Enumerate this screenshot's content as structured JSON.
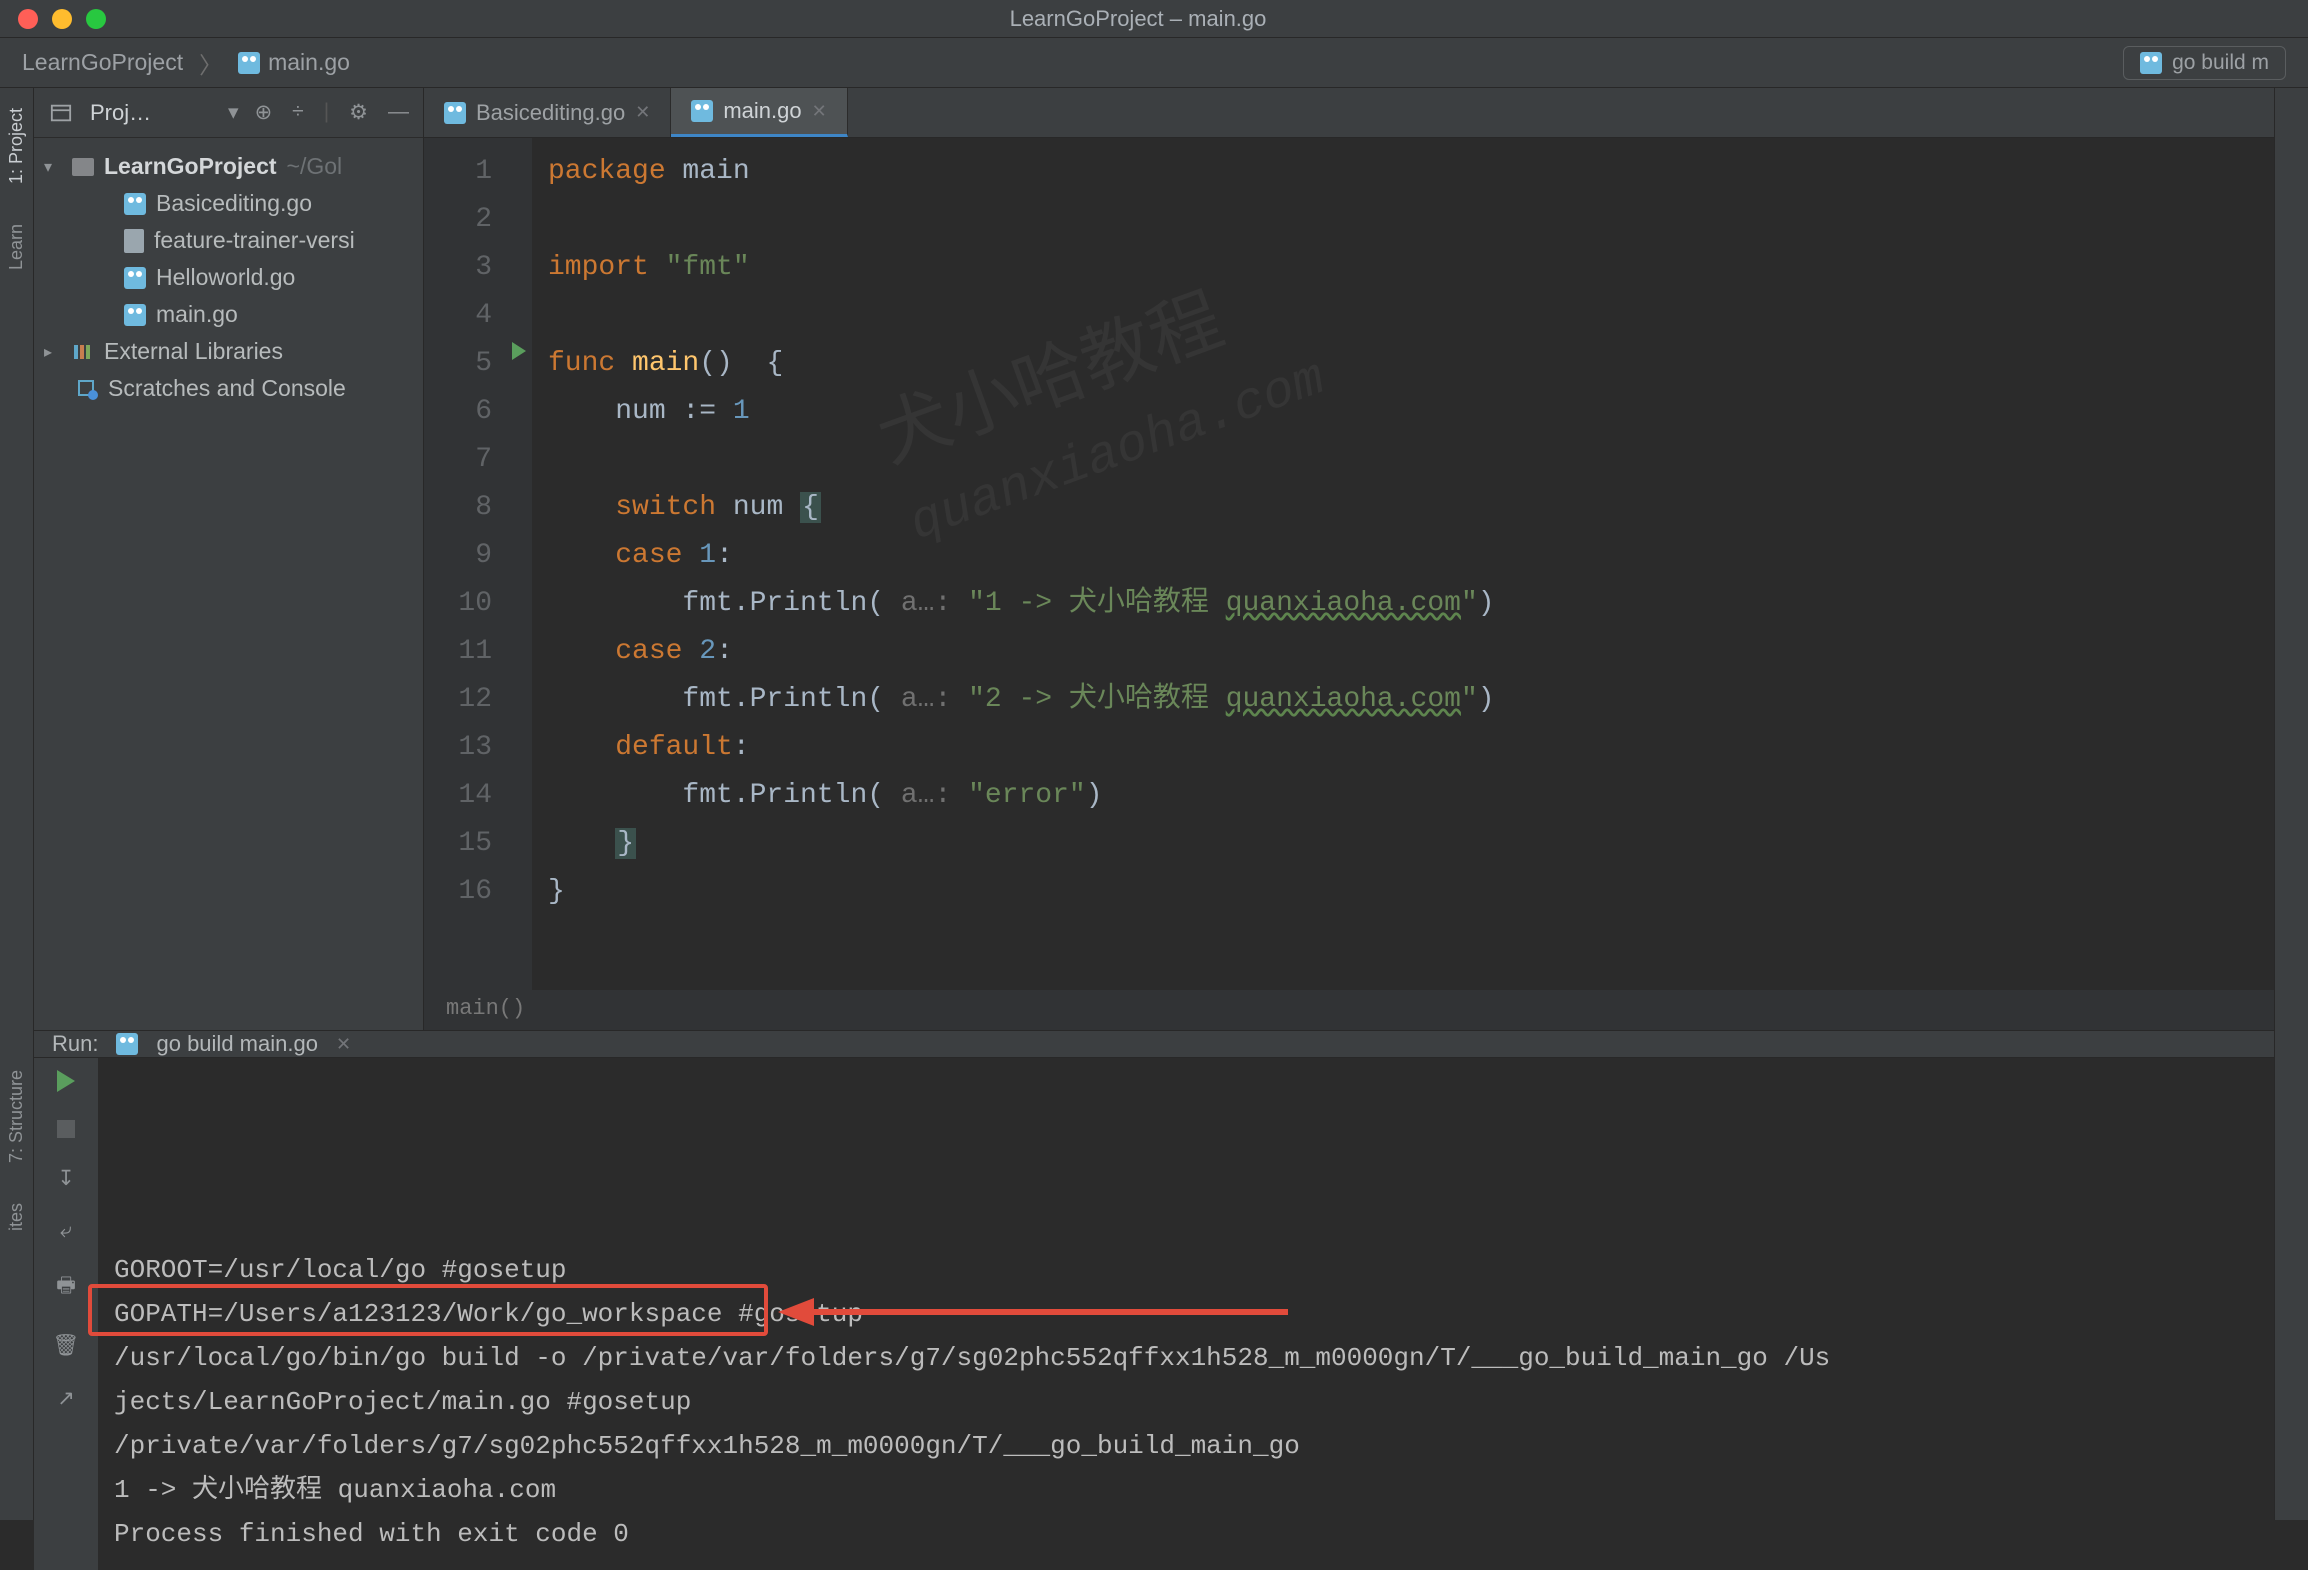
{
  "window": {
    "title": "LearnGoProject – main.go"
  },
  "breadcrumb": {
    "project": "LearnGoProject",
    "file": "main.go",
    "run_config": "go build m"
  },
  "left_rail": {
    "project": "1: Project",
    "learn": "Learn"
  },
  "left_rail_bottom": {
    "structure": "7: Structure",
    "favorites": "ites"
  },
  "project_panel": {
    "title": "Proj…",
    "tree": {
      "root": "LearnGoProject",
      "root_path": "~/Gol",
      "files": [
        "Basicediting.go",
        "feature-trainer-versi",
        "Helloworld.go",
        "main.go"
      ],
      "external": "External Libraries",
      "scratches": "Scratches and Console"
    }
  },
  "editor": {
    "tabs": [
      {
        "label": "Basicediting.go",
        "active": false
      },
      {
        "label": "main.go",
        "active": true
      }
    ],
    "lines": [
      {
        "n": 1,
        "segs": [
          [
            "kw",
            "package "
          ],
          [
            "pkg",
            "main"
          ]
        ]
      },
      {
        "n": 2,
        "segs": []
      },
      {
        "n": 3,
        "segs": [
          [
            "kw",
            "import "
          ],
          [
            "str",
            "\"fmt\""
          ]
        ]
      },
      {
        "n": 4,
        "segs": []
      },
      {
        "n": 5,
        "segs": [
          [
            "kw",
            "func "
          ],
          [
            "fn",
            "main"
          ],
          [
            "ident",
            "()  {"
          ]
        ]
      },
      {
        "n": 6,
        "segs": [
          [
            "ident",
            "    num := "
          ],
          [
            "num",
            "1"
          ]
        ]
      },
      {
        "n": 7,
        "segs": []
      },
      {
        "n": 8,
        "segs": [
          [
            "ident",
            "    "
          ],
          [
            "kw",
            "switch"
          ],
          [
            "ident",
            " num "
          ],
          [
            "hl",
            "{"
          ]
        ]
      },
      {
        "n": 9,
        "segs": [
          [
            "ident",
            "    "
          ],
          [
            "kw",
            "case"
          ],
          [
            "ident",
            " "
          ],
          [
            "num",
            "1"
          ],
          [
            "ident",
            ":"
          ]
        ]
      },
      {
        "n": 10,
        "segs": [
          [
            "ident",
            "        fmt.Println( "
          ],
          [
            "hint",
            "a…: "
          ],
          [
            "str",
            "\"1 -> 犬小哈教程 "
          ],
          [
            "url",
            "quanxiaoha.com"
          ],
          [
            "str",
            "\""
          ],
          [
            "ident",
            ")"
          ]
        ]
      },
      {
        "n": 11,
        "segs": [
          [
            "ident",
            "    "
          ],
          [
            "kw",
            "case"
          ],
          [
            "ident",
            " "
          ],
          [
            "num",
            "2"
          ],
          [
            "ident",
            ":"
          ]
        ]
      },
      {
        "n": 12,
        "segs": [
          [
            "ident",
            "        fmt.Println( "
          ],
          [
            "hint",
            "a…: "
          ],
          [
            "str",
            "\"2 -> 犬小哈教程 "
          ],
          [
            "url",
            "quanxiaoha.com"
          ],
          [
            "str",
            "\""
          ],
          [
            "ident",
            ")"
          ]
        ]
      },
      {
        "n": 13,
        "segs": [
          [
            "ident",
            "    "
          ],
          [
            "kw",
            "default"
          ],
          [
            "ident",
            ":"
          ]
        ]
      },
      {
        "n": 14,
        "segs": [
          [
            "ident",
            "        fmt.Println( "
          ],
          [
            "hint",
            "a…: "
          ],
          [
            "str",
            "\"error\""
          ],
          [
            "ident",
            ")"
          ]
        ]
      },
      {
        "n": 15,
        "segs": [
          [
            "ident",
            "    "
          ],
          [
            "hl",
            "}"
          ]
        ]
      },
      {
        "n": 16,
        "segs": [
          [
            "ident",
            "}"
          ]
        ]
      }
    ],
    "status": "main()"
  },
  "watermark": {
    "line1": "犬小哈教程",
    "line2": "quanxiaoha.com"
  },
  "run": {
    "label": "Run:",
    "config": "go build main.go",
    "console_lines": [
      "GOROOT=/usr/local/go #gosetup",
      "GOPATH=/Users/a123123/Work/go_workspace #gosetup",
      "/usr/local/go/bin/go build -o /private/var/folders/g7/sg02phc552qffxx1h528_m_m0000gn/T/___go_build_main_go /Us",
      "jects/LearnGoProject/main.go #gosetup",
      "/private/var/folders/g7/sg02phc552qffxx1h528_m_m0000gn/T/___go_build_main_go",
      "1 -> 犬小哈教程 quanxiaoha.com",
      "",
      "Process finished with exit code 0"
    ]
  }
}
